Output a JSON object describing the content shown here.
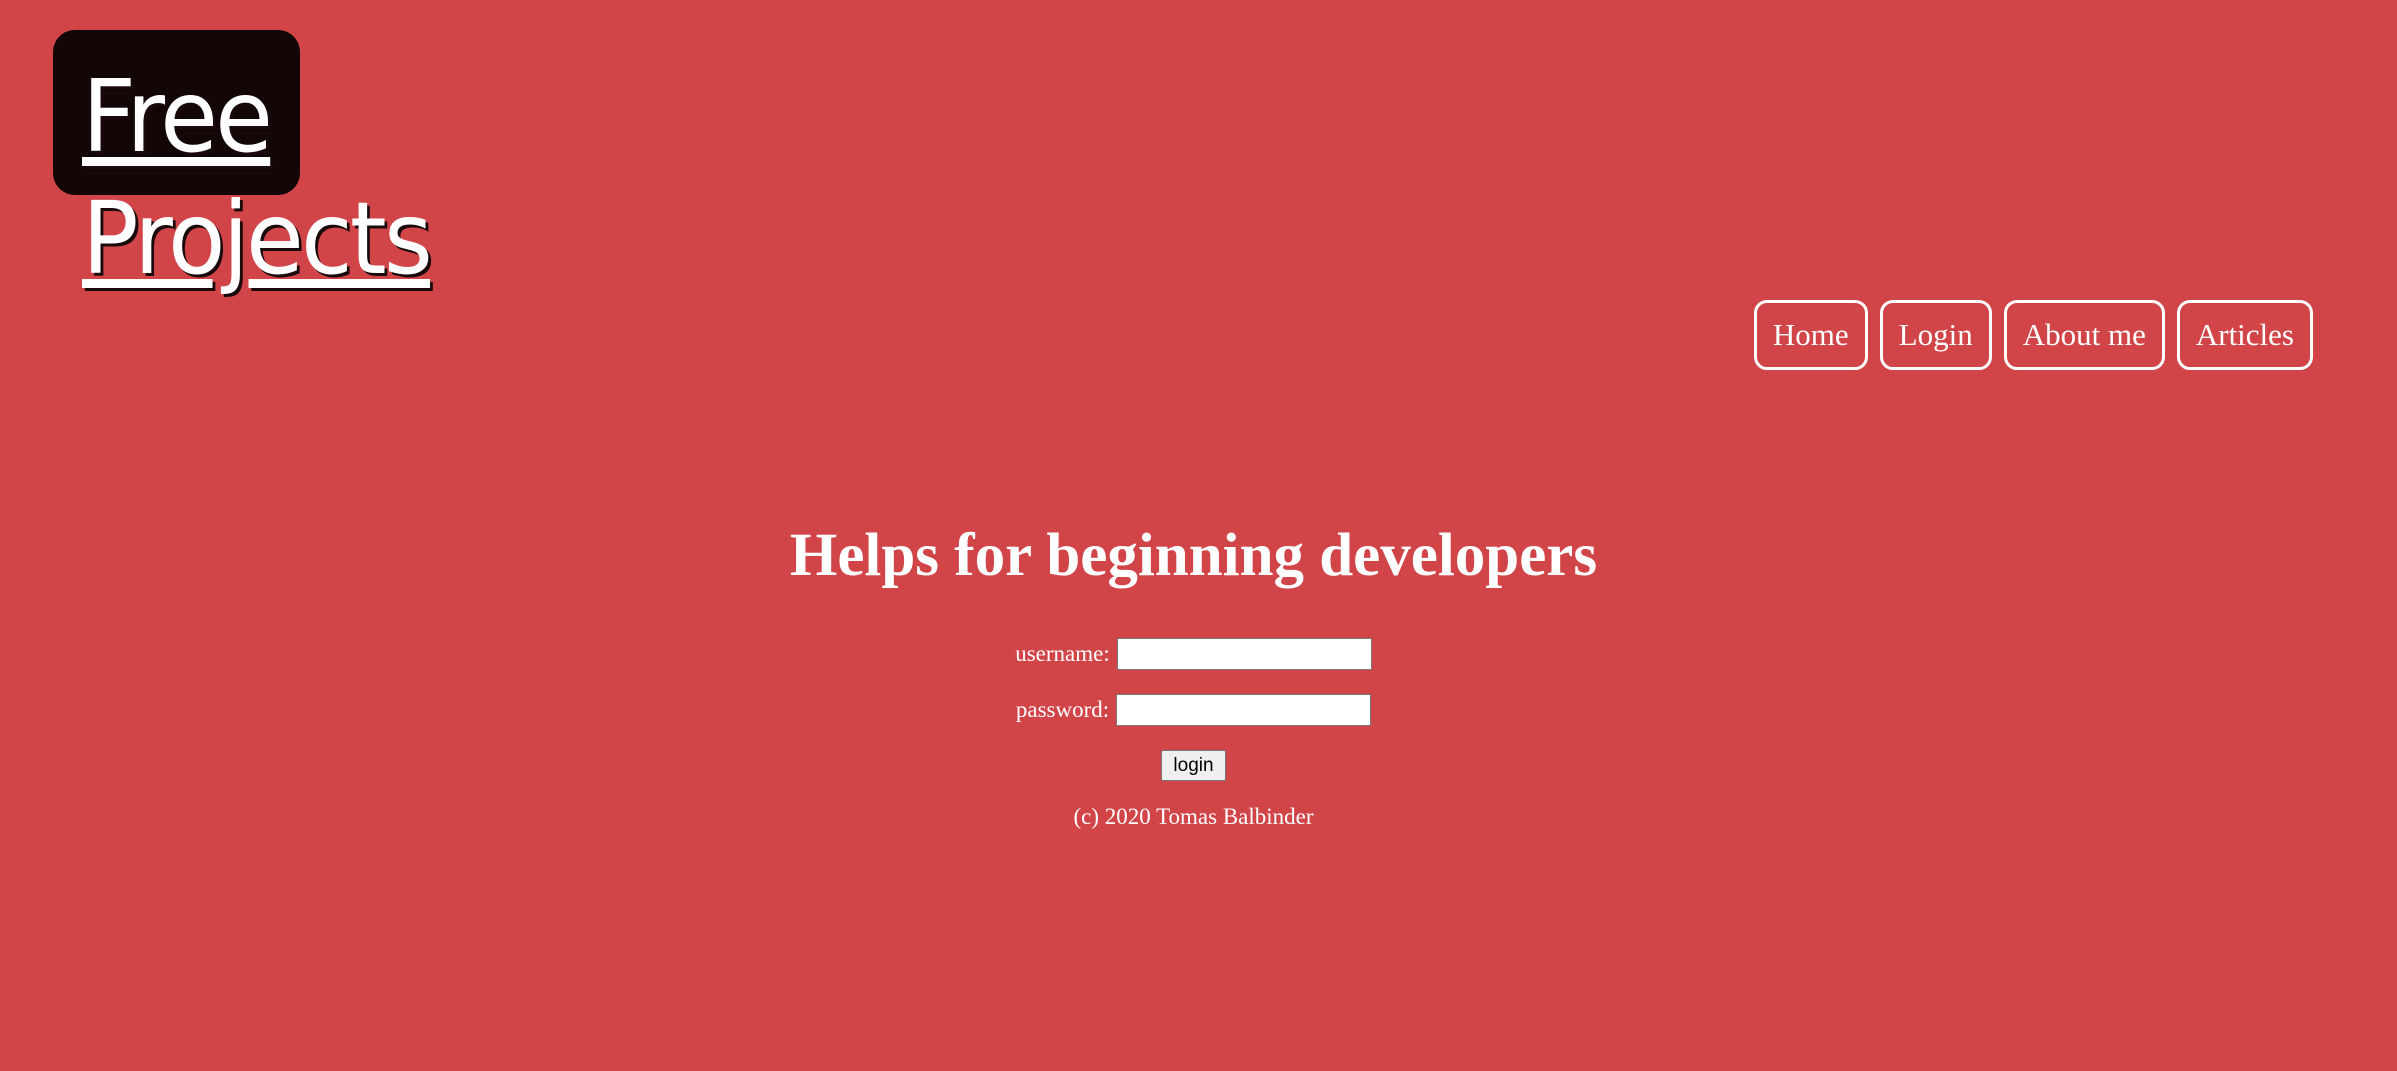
{
  "logo": {
    "line1": "Free",
    "line2": "Projects"
  },
  "nav": {
    "items": [
      {
        "label": "Home"
      },
      {
        "label": "Login"
      },
      {
        "label": "About me"
      },
      {
        "label": "Articles"
      }
    ]
  },
  "main": {
    "heading": "Helps for beginning developers",
    "form": {
      "username_label": "username:",
      "username_value": "",
      "password_label": "password:",
      "password_value": "",
      "submit_label": "login"
    },
    "footer": "(c) 2020 Tomas Balbinder"
  },
  "colors": {
    "background": "#d14549",
    "logo_box": "#120607",
    "text": "#ffffff"
  }
}
